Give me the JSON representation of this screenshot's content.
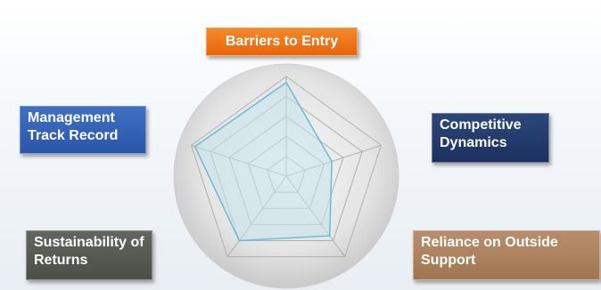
{
  "chart_data": {
    "type": "radar",
    "categories": [
      "Barriers to Entry",
      "Competitive Dynamics",
      "Reliance on Outside Support",
      "Sustainability of Returns",
      "Management Track Record"
    ],
    "levels": 5,
    "rmax": 5,
    "values": [
      4.7,
      2.4,
      3.7,
      4.0,
      4.8
    ],
    "colors": {
      "fill": "#c5e3ec",
      "stroke": "#6bbbd6",
      "grid": "#b0b0b0",
      "disc_light": "#f7f7f7",
      "disc_dark": "#cccccc"
    }
  },
  "labels": {
    "top": "Barriers to Entry",
    "right": "Competitive Dynamics",
    "bottom_right": "Reliance on Outside Support",
    "bottom_left": "Sustainability of Returns",
    "left": "Management Track Record"
  }
}
